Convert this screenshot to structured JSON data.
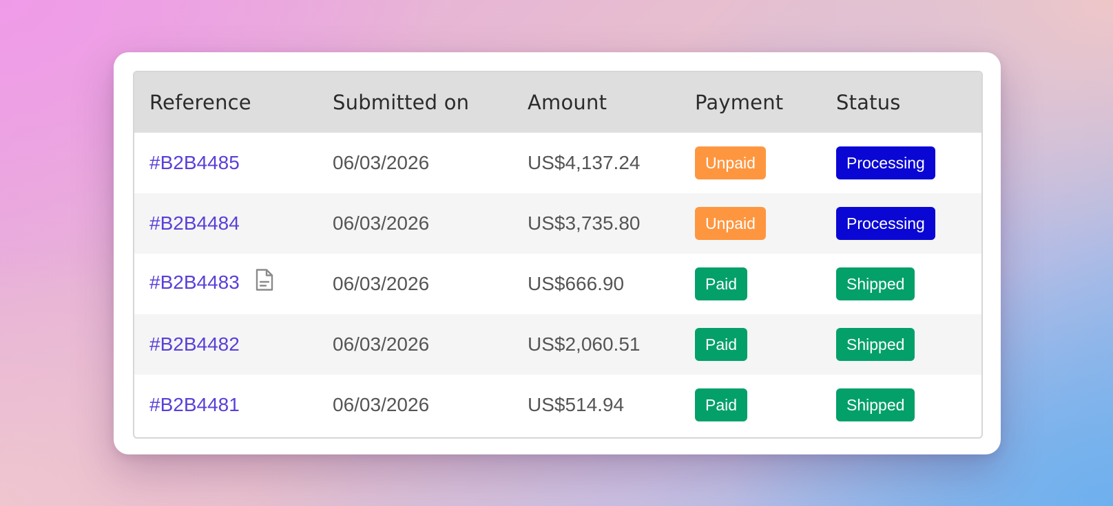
{
  "table": {
    "headers": {
      "reference": "Reference",
      "submitted_on": "Submitted on",
      "amount": "Amount",
      "payment": "Payment",
      "status": "Status"
    },
    "rows": [
      {
        "reference": "#B2B4485",
        "has_document": false,
        "submitted_on": "06/03/2026",
        "amount": "US$4,137.24",
        "payment": "Unpaid",
        "status": "Processing"
      },
      {
        "reference": "#B2B4484",
        "has_document": false,
        "submitted_on": "06/03/2026",
        "amount": "US$3,735.80",
        "payment": "Unpaid",
        "status": "Processing"
      },
      {
        "reference": "#B2B4483",
        "has_document": true,
        "document_icon": "document-icon",
        "submitted_on": "06/03/2026",
        "amount": "US$666.90",
        "payment": "Paid",
        "status": "Shipped"
      },
      {
        "reference": "#B2B4482",
        "has_document": false,
        "submitted_on": "06/03/2026",
        "amount": "US$2,060.51",
        "payment": "Paid",
        "status": "Shipped"
      },
      {
        "reference": "#B2B4481",
        "has_document": false,
        "submitted_on": "06/03/2026",
        "amount": "US$514.94",
        "payment": "Paid",
        "status": "Shipped"
      }
    ]
  },
  "colors": {
    "link": "#5a3fd8",
    "unpaid": "#fe9640",
    "paid": "#04a06a",
    "processing": "#0a07d4",
    "shipped": "#04a06a",
    "header_bg": "#dedede"
  }
}
